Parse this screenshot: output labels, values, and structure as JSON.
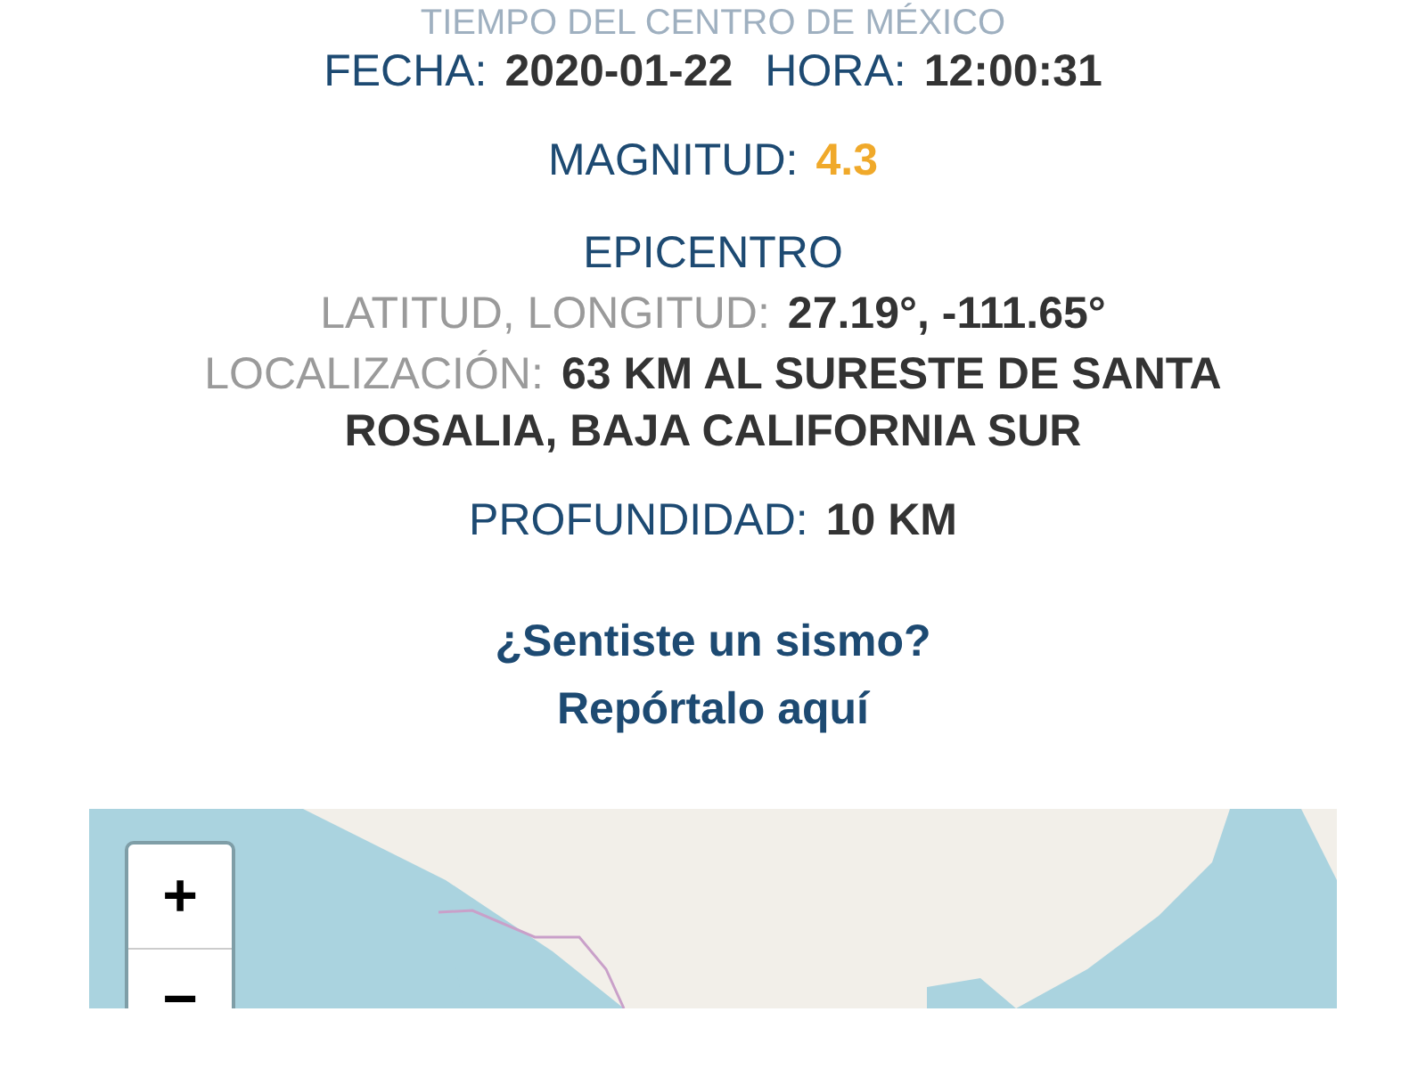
{
  "time_zone_note": "TIEMPO DEL CENTRO DE MÉXICO",
  "date_line": [
    {
      "label": "FECHA:",
      "value": "2020-01-22"
    },
    {
      "label": "HORA:",
      "value": "12:00:31"
    }
  ],
  "magnitude": {
    "label": "MAGNITUD:",
    "value": "4.3"
  },
  "epicenter": {
    "heading": "EPICENTRO",
    "fields": [
      {
        "label": "LATITUD, LONGITUD:",
        "value": "27.19°, -111.65°"
      },
      {
        "label": "LOCALIZACIÓN:",
        "value": "63 KM AL SURESTE DE SANTA ROSALIA, BAJA CALIFORNIA SUR"
      }
    ]
  },
  "depth": {
    "label": "PROFUNDIDAD:",
    "value": "10 KM"
  },
  "report": {
    "question": "¿Sentiste un sismo?",
    "link": "Repórtalo aquí"
  },
  "map": {
    "kind": "picture",
    "zoom_in": "+",
    "zoom_out": "−"
  }
}
